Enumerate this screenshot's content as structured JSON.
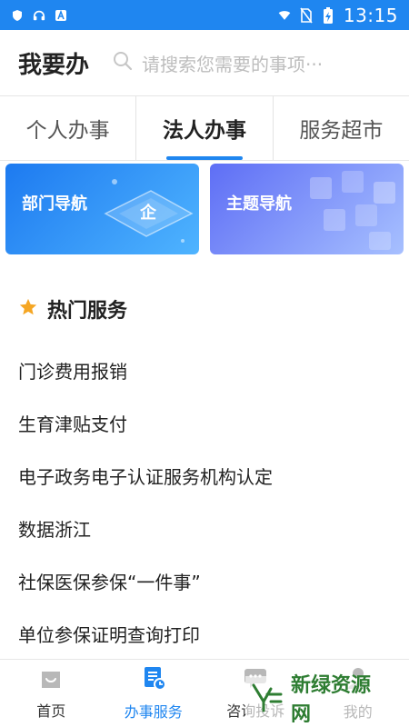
{
  "status_bar": {
    "time": "13:15",
    "icons": [
      "shield-icon",
      "headset-icon",
      "a-icon",
      "wifi-icon",
      "no-sim-icon",
      "battery-charging-icon"
    ]
  },
  "header": {
    "title": "我要办",
    "search_placeholder": "请搜索您需要的事项···"
  },
  "tabs": [
    {
      "label": "个人办事",
      "active": false
    },
    {
      "label": "法人办事",
      "active": true
    },
    {
      "label": "服务超市",
      "active": false
    }
  ],
  "banners": [
    {
      "label": "部门导航"
    },
    {
      "label": "主题导航"
    }
  ],
  "hot_services": {
    "title": "热门服务",
    "items": [
      "门诊费用报销",
      "生育津贴支付",
      "电子政务电子认证服务机构认定",
      "数据浙江",
      "社保医保参保“一件事”",
      "单位参保证明查询打印"
    ]
  },
  "bottom_nav": [
    {
      "label": "首页",
      "icon": "home-icon",
      "active": false
    },
    {
      "label": "办事服务",
      "icon": "service-doc-icon",
      "active": true
    },
    {
      "label": "咨询投诉",
      "icon": "chat-icon",
      "active": false
    },
    {
      "label": "我的",
      "icon": "user-icon",
      "active": false
    }
  ],
  "watermark": {
    "text": "新绿资源网"
  },
  "colors": {
    "primary": "#1f86f0",
    "star": "#f5a623"
  }
}
